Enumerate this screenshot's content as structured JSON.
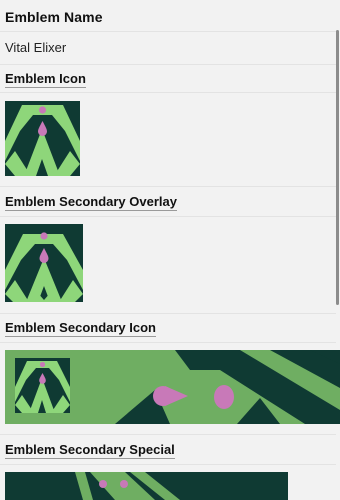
{
  "emblem_name": {
    "heading": "Emblem Name",
    "value": "Vital Elixer"
  },
  "emblem_icon": {
    "heading": "Emblem Icon",
    "image_name": "vital-elixer-emblem-icon"
  },
  "emblem_secondary_overlay": {
    "heading": "Emblem Secondary Overlay",
    "image_name": "vital-elixer-secondary-overlay"
  },
  "emblem_secondary_icon": {
    "heading": "Emblem Secondary Icon",
    "image_name": "vital-elixer-secondary-icon-banner"
  },
  "emblem_secondary_special": {
    "heading": "Emblem Secondary Special",
    "image_name": "vital-elixer-secondary-special-banner"
  },
  "colors": {
    "emblem_dark": "#0f3a33",
    "emblem_green": "#8ed67a",
    "emblem_pink": "#c879b8",
    "banner_green": "#6fae62"
  }
}
